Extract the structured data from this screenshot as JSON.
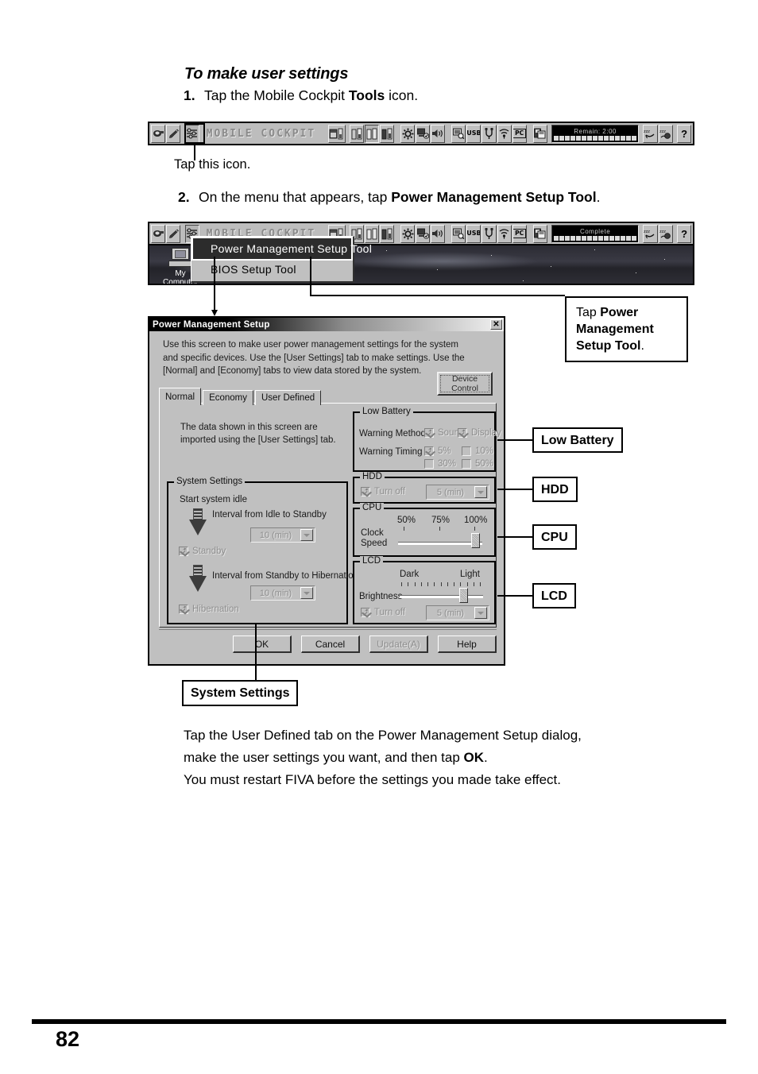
{
  "page": {
    "number": "82"
  },
  "heading": "To make user settings",
  "steps": [
    {
      "num": "1.",
      "text_before": "Tap the Mobile Cockpit ",
      "bold": "Tools",
      "text_after": " icon."
    },
    {
      "num": "2.",
      "text_before": "On the menu that appears, tap ",
      "bold": "Power Management Setup Tool",
      "text_after": "."
    }
  ],
  "tap_this_icon": "Tap this icon.",
  "cockpit": {
    "title": "MOBILE COCKPIT",
    "battery_remain": "Remain:  2:00",
    "battery_complete": "Complete",
    "help_label": "?",
    "usb_label": "USB",
    "pc_label": "PC"
  },
  "desktop": {
    "my_computer_line1": "My",
    "my_computer_line2": "Computer"
  },
  "menu": {
    "items": [
      {
        "label": "Power Management Setup Tool",
        "selected": true
      },
      {
        "label": "BIOS Setup Tool",
        "selected": false
      }
    ]
  },
  "dialog": {
    "title": "Power Management Setup",
    "close_label": "✕",
    "description": "Use this screen to make user power management settings for the system and specific devices. Use the [User Settings] tab to make settings. Use the [Normal] and [Economy] tabs to view data stored by the system.",
    "device_control_line1": "Device",
    "device_control_line2": "Control",
    "tabs": [
      {
        "label": "Normal",
        "active": true
      },
      {
        "label": "Economy",
        "active": false
      },
      {
        "label": "User Defined",
        "active": false
      }
    ],
    "panel_note": "The data shown in this screen are imported using the [User Settings] tab.",
    "system_settings": {
      "legend": "System Settings",
      "start_system_idle": "Start system idle",
      "interval_idle_to_standby": "Interval from Idle to Standby",
      "idle_to_standby_value": "10 (min)",
      "standby_label": "Standby",
      "standby_checked": true,
      "interval_standby_to_hibernation": "Interval from Standby to Hibernation",
      "standby_to_hibernation_value": "10 (min)",
      "hibernation_label": "Hibernation",
      "hibernation_checked": true
    },
    "low_battery": {
      "legend": "Low Battery",
      "warning_method_label": "Warning Method",
      "warning_method_options": [
        {
          "label": "Sound",
          "checked": true
        },
        {
          "label": "Display",
          "checked": true
        }
      ],
      "warning_timing_label": "Warning Timing",
      "warning_timing_options": [
        {
          "label": "5%",
          "checked": true
        },
        {
          "label": "10%",
          "checked": false
        },
        {
          "label": "30%",
          "checked": false
        },
        {
          "label": "50%",
          "checked": false
        }
      ]
    },
    "hdd": {
      "legend": "HDD",
      "turn_off_label": "Turn off",
      "turn_off_checked": true,
      "turn_off_value": "5 (min)"
    },
    "cpu": {
      "legend": "CPU",
      "clock_speed_label_line1": "Clock",
      "clock_speed_label_line2": "Speed",
      "scale": [
        "50%",
        "75%",
        "100%"
      ],
      "value_percent": 100
    },
    "lcd": {
      "legend": "LCD",
      "brightness_label": "Brightness",
      "scale_left": "Dark",
      "scale_right": "Light",
      "brightness_percent": 82,
      "turn_off_label": "Turn off",
      "turn_off_checked": true,
      "turn_off_value": "5 (min)"
    },
    "buttons": [
      {
        "label": "OK",
        "enabled": true
      },
      {
        "label": "Cancel",
        "enabled": true
      },
      {
        "label": "Update(A)",
        "enabled": false
      },
      {
        "label": "Help",
        "enabled": true
      }
    ]
  },
  "callouts": {
    "tap_power_tool_lead": "Tap ",
    "tap_power_tool_bold": "Power Management Setup Tool",
    "tap_power_tool_tail": ".",
    "low_battery": "Low Battery",
    "hdd": "HDD",
    "cpu": "CPU",
    "lcd": "LCD",
    "system_settings": "System Settings"
  },
  "closing_text": {
    "line1_a": "Tap the User Defined tab on the Power Management Setup dialog,",
    "line2_a": "make the user settings you want, and then tap ",
    "line2_bold": "OK",
    "line2_b": ".",
    "line3": "You must restart FIVA before the settings you made take effect."
  }
}
